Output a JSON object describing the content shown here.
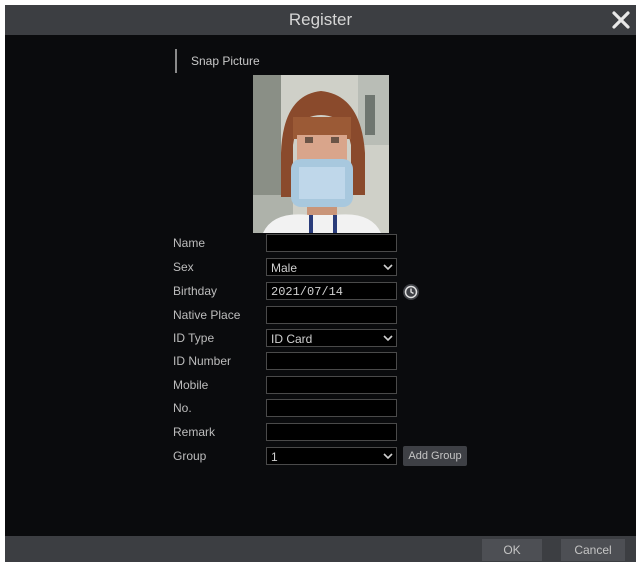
{
  "dialog": {
    "title": "Register",
    "close_icon": "close-icon"
  },
  "snap": {
    "section_title": "Snap Picture"
  },
  "form": {
    "name_label": "Name",
    "name_value": "",
    "sex_label": "Sex",
    "sex_value": "Male",
    "birthday_label": "Birthday",
    "birthday_value": "2021/07/14",
    "native_place_label": "Native Place",
    "native_place_value": "",
    "id_type_label": "ID Type",
    "id_type_value": "ID Card",
    "id_number_label": "ID Number",
    "id_number_value": "",
    "mobile_label": "Mobile",
    "mobile_value": "",
    "no_label": "No.",
    "no_value": "",
    "remark_label": "Remark",
    "remark_value": "",
    "group_label": "Group",
    "group_value": "1",
    "add_group_label": "Add Group"
  },
  "footer": {
    "ok_label": "OK",
    "cancel_label": "Cancel"
  },
  "colors": {
    "background": "#0a0b0d",
    "titlebar": "#3c3e42",
    "field_border": "#4a4a4a"
  }
}
